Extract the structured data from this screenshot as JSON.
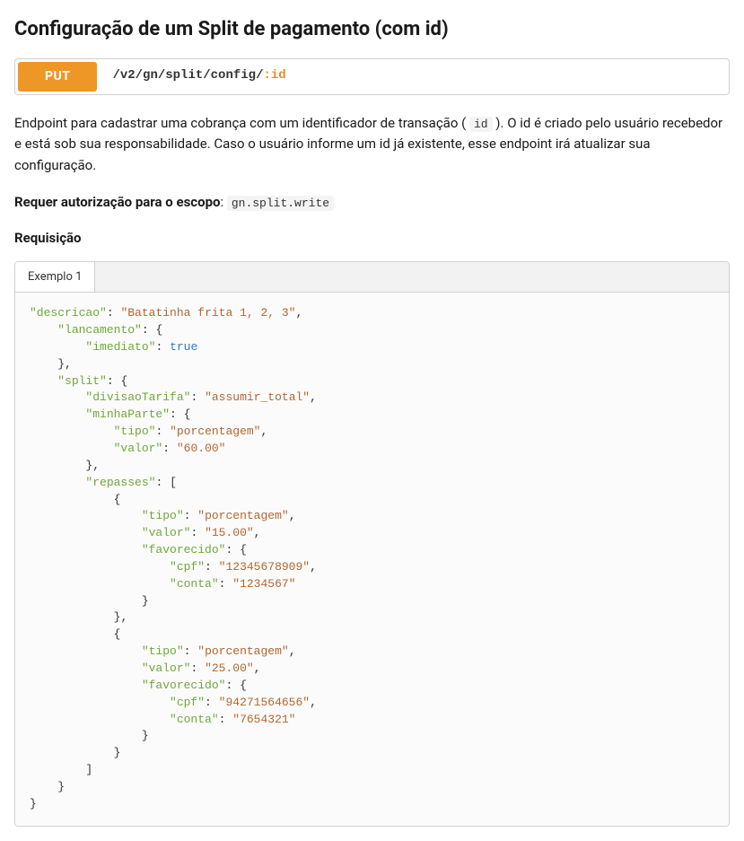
{
  "title": "Configuração de um Split de pagamento (com id)",
  "endpoint": {
    "method": "PUT",
    "path_prefix": "/v2/gn/split/config/",
    "path_param": ":id"
  },
  "description": {
    "before_code": "Endpoint para cadastrar uma cobrança com um identificador de transação ( ",
    "code": "id",
    "after_code": " ). O id é criado pelo usuário recebedor e está sob sua responsabilidade. Caso o usuário informe um id já existente, esse endpoint irá atualizar sua configuração."
  },
  "auth": {
    "label": "Requer autorização para o escopo",
    "sep": ": ",
    "scope_code": "gn.split.write"
  },
  "request_heading": "Requisição",
  "tab_label": "Exemplo 1",
  "example": {
    "descricao": "Batatinha frita 1, 2, 3",
    "lancamento": {
      "imediato": true
    },
    "split": {
      "divisaoTarifa": "assumir_total",
      "minhaParte": {
        "tipo": "porcentagem",
        "valor": "60.00"
      },
      "repasses": [
        {
          "tipo": "porcentagem",
          "valor": "15.00",
          "favorecido": {
            "cpf": "12345678909",
            "conta": "1234567"
          }
        },
        {
          "tipo": "porcentagem",
          "valor": "25.00",
          "favorecido": {
            "cpf": "94271564656",
            "conta": "7654321"
          }
        }
      ]
    }
  }
}
